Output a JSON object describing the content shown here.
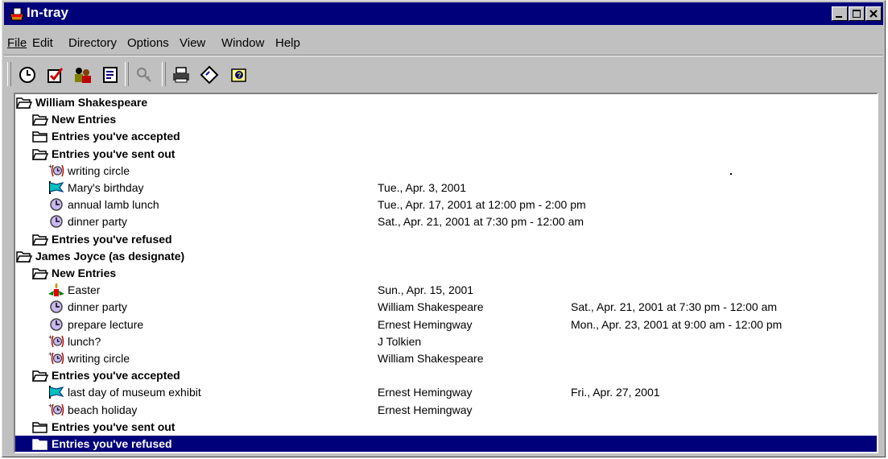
{
  "window": {
    "title": "In-tray"
  },
  "menu": [
    "File",
    "Edit",
    "Directory",
    "Options",
    "View",
    "Window",
    "Help"
  ],
  "toolbar": {
    "buttons": [
      "clock-icon",
      "checkbox-icon",
      "people-icon",
      "address-book-icon",
      "disabled-tool-icon",
      "printer-icon",
      "ticket-icon",
      "help-icon"
    ]
  },
  "tree": {
    "rows": [
      {
        "label": "William Shakespeare",
        "icon": "open-folder-icon",
        "bold": true
      },
      {
        "label": "New Entries",
        "icon": "open-folder-icon",
        "bold": true
      },
      {
        "label": "Entries you've accepted",
        "icon": "folder-icon",
        "bold": true
      },
      {
        "label": "Entries you've sent out",
        "icon": "open-folder-icon",
        "bold": true
      },
      {
        "label": "writing circle",
        "icon": "new-meeting-icon"
      },
      {
        "label": "Mary's birthday",
        "icon": "event-flag-icon",
        "col2": "Tue., Apr. 3, 2001"
      },
      {
        "label": "annual lamb lunch",
        "icon": "clock-entry-icon",
        "col2": "Tue., Apr. 17, 2001 at 12:00 pm - 2:00 pm"
      },
      {
        "label": "dinner party",
        "icon": "clock-entry-icon",
        "col2": "Sat., Apr. 21, 2001 at 7:30 pm - 12:00 am"
      },
      {
        "label": "Entries you've refused",
        "icon": "open-folder-icon",
        "bold": true
      },
      {
        "label": "James Joyce  (as designate)",
        "icon": "open-folder-icon",
        "bold": true
      },
      {
        "label": "New Entries",
        "icon": "open-folder-icon",
        "bold": true
      },
      {
        "label": "Easter",
        "icon": "holiday-icon",
        "col2": "Sun., Apr. 15, 2001"
      },
      {
        "label": "dinner party",
        "icon": "clock-entry-icon",
        "col2": "William Shakespeare",
        "col3": "Sat., Apr. 21, 2001 at 7:30 pm - 12:00 am"
      },
      {
        "label": "prepare lecture",
        "icon": "clock-entry-icon",
        "col2": "Ernest Hemingway",
        "col3": "Mon., Apr. 23, 2001 at 9:00 am - 12:00 pm"
      },
      {
        "label": "lunch?",
        "icon": "new-meeting-icon",
        "col2": "J Tolkien"
      },
      {
        "label": "writing circle",
        "icon": "new-meeting-icon",
        "col2": "William Shakespeare"
      },
      {
        "label": "Entries you've accepted",
        "icon": "open-folder-icon",
        "bold": true
      },
      {
        "label": "last day of museum exhibit",
        "icon": "event-flag-icon",
        "col2": "Ernest Hemingway",
        "col3": "Fri., Apr. 27, 2001"
      },
      {
        "label": "beach holiday",
        "icon": "new-meeting-icon",
        "col2": "Ernest Hemingway"
      },
      {
        "label": "Entries you've sent out",
        "icon": "folder-icon",
        "bold": true
      },
      {
        "label": "Entries you've refused",
        "icon": "folder-icon",
        "bold": true,
        "selected": true
      }
    ]
  },
  "colors": {
    "titlebar": "#00007b",
    "selection": "#00007b",
    "chrome": "#c0c0c0"
  }
}
